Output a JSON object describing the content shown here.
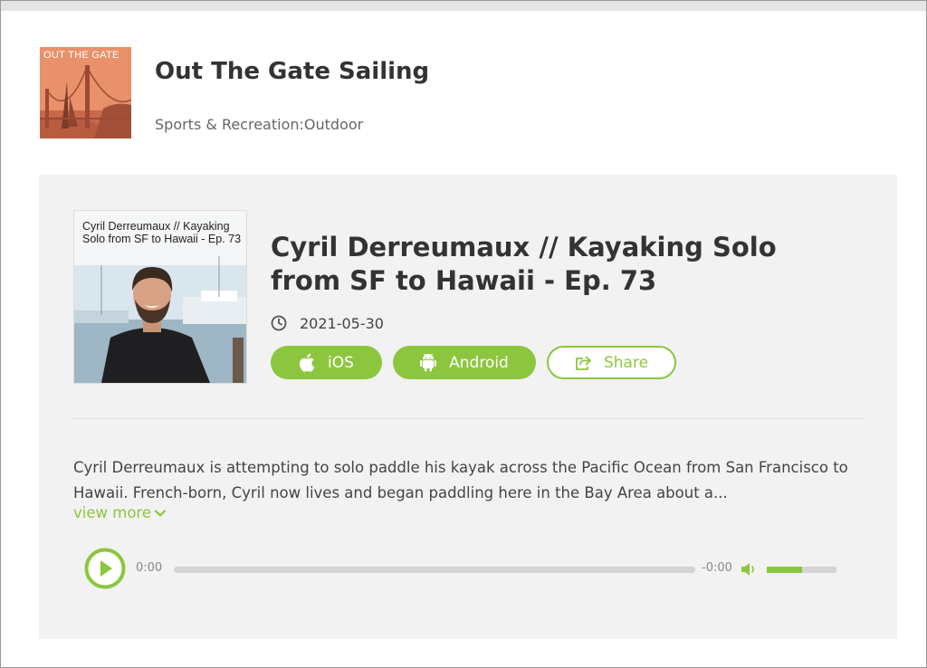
{
  "podcast": {
    "art_text": "OUT THE GATE",
    "title": "Out The Gate Sailing",
    "category": "Sports & Recreation:Outdoor"
  },
  "episode": {
    "art_caption": "Cyril Derreumaux // Kayaking Solo from SF to Hawaii - Ep. 73",
    "title": "Cyril Derreumaux // Kayaking Solo from SF to Hawaii - Ep. 73",
    "date": "2021-05-30",
    "description": "Cyril Derreumaux is attempting to solo paddle his kayak across the Pacific Ocean from San Francisco to Hawaii. French-born, Cyril now lives and began paddling here in the Bay Area about a...",
    "view_more_label": "view more"
  },
  "buttons": {
    "ios_label": "iOS",
    "android_label": "Android",
    "share_label": "Share"
  },
  "player": {
    "current_time": "0:00",
    "remaining_time": "-0:00",
    "progress": 0,
    "volume": 0.5
  },
  "colors": {
    "accent": "#8cc63e",
    "panel_bg": "#f2f2f2",
    "podcast_art_bg": "#e58a63"
  },
  "icons": {
    "date": "clock-icon",
    "ios": "apple-icon",
    "android": "android-icon",
    "share": "share-icon",
    "view_more": "chevron-down-icon",
    "play": "play-icon",
    "volume": "volume-icon"
  }
}
